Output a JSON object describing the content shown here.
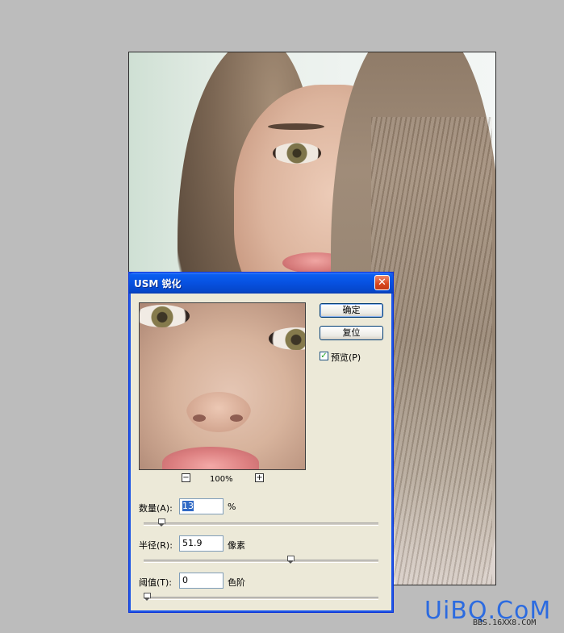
{
  "dialog": {
    "title": "USM 锐化",
    "close_glyph": "✕",
    "zoom_out_glyph": "−",
    "zoom_in_glyph": "+",
    "zoom_level": "100%",
    "ok_label": "确定",
    "reset_label": "复位",
    "preview_label": "预览(P)",
    "preview_checked": true,
    "check_glyph": "✓",
    "amount": {
      "label": "数量(A):",
      "value": "13",
      "unit": "%",
      "slider_fraction": 0.065
    },
    "radius": {
      "label": "半径(R):",
      "value": "51.9",
      "unit": "像素",
      "slider_fraction": 0.63
    },
    "threshold": {
      "label": "阈值(T):",
      "value": "0",
      "unit": "色阶",
      "slider_fraction": 0.0
    }
  },
  "watermark": {
    "text": "UiBQ.CoM",
    "sub": "BBS.16XX8.COM"
  },
  "colors": {
    "titlebar": "#0751e0",
    "dialog_bg": "#ece9d8",
    "close": "#d8461d",
    "watermark": "#2c6be0"
  }
}
